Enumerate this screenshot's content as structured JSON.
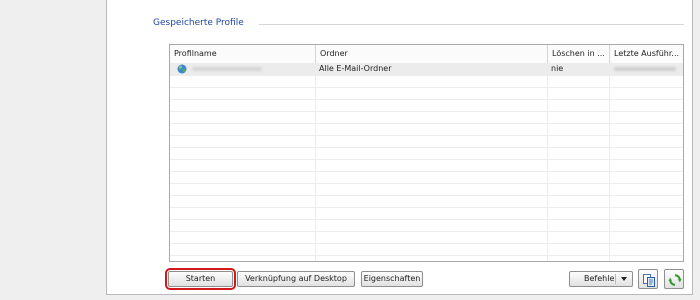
{
  "group": {
    "title": "Gespeicherte Profile"
  },
  "table": {
    "columns": [
      "Profilname",
      "Ordner",
      "Löschen in ...",
      "Letzte Ausführ..."
    ],
    "rows": [
      {
        "profile_name": "",
        "folder": "Alle E-Mail-Ordner",
        "delete_in": "nie",
        "last_run": ""
      }
    ],
    "empty_rows": 15
  },
  "buttons": {
    "start": "Starten",
    "shortcut": "Verknüpfung auf Desktop",
    "properties": "Eigenschaften",
    "commands": "Befehle"
  },
  "icons": {
    "profile": "globe-icon",
    "copy": "copy-icon",
    "refresh": "refresh-icon",
    "dropdown": "chevron-down-icon"
  },
  "colors": {
    "group_title": "#1f46a3",
    "start_highlight": "#d11919"
  }
}
